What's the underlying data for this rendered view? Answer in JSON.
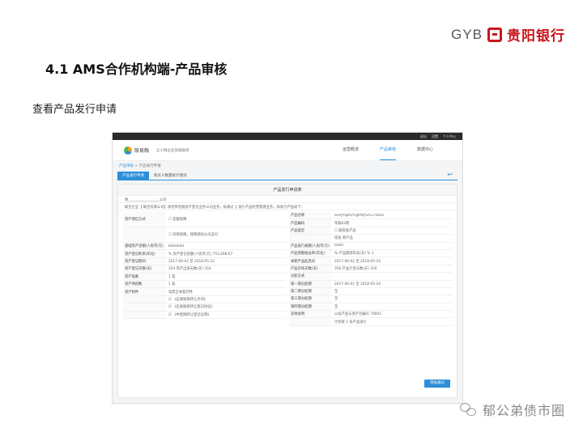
{
  "logo": {
    "latin": "GYB",
    "cn": "贵阳银行"
  },
  "slide": {
    "title": "4.1 AMS合作机构端-产品审核",
    "subtitle": "查看产品发行申请"
  },
  "app": {
    "topbar": [
      "退出",
      "设置",
      "个人中心"
    ],
    "brand": "联易融",
    "slogan": "让小微企业快速融资",
    "nav": [
      "运营概述",
      "产品审核",
      "数据中心"
    ],
    "breadcrumb": [
      "产品审核",
      "产品发行申请"
    ],
    "tabs": [
      "产品发行申请",
      "购买人数量统计情况"
    ],
    "panel_title": "产品发行申请表",
    "lines": [
      "致__________________公司",
      "联合企业【      联合有限公司】承担单金融资产登记业务公司业务，拟通过【      发行产品经营管理业务，拟发行产品如下："
    ],
    "left_rows": [
      {
        "label": "资产增信方式",
        "value": "☐ 差额保障",
        "tall": true
      },
      {
        "label": "",
        "value": "☐ 有限保障，保障授权公司支付",
        "tall": true
      },
      {
        "label": "基础资产金额(人民币/元)",
        "value": "8000000"
      },
      {
        "label": "资产登记利率(年化)",
        "value": "%   资产登记金额(人民币/元)  753,268.67"
      },
      {
        "label": "资产登记期间",
        "value": "2017-06-02   至  2018-05-22"
      },
      {
        "label": "资产登记天数(天)",
        "value": "354   资产出表天数(天)  354"
      },
      {
        "label": "资产笔数",
        "value": "1   笔"
      },
      {
        "label": "资产债权数",
        "value": "1   家"
      },
      {
        "label": "资产附件",
        "value": "电票正本复印件"
      },
      {
        "label": "",
        "value": "☑ 《应收账款转让合同》"
      },
      {
        "label": "",
        "value": "☑ 《应收账款转让登记协议》"
      },
      {
        "label": "",
        "value": "☑ 《中登网转让登记证明》"
      }
    ],
    "right_rows": [
      {
        "label": "产品名称",
        "value": "SFHJYSJKSYQJHNJY20170602"
      },
      {
        "label": "产品编码",
        "value": "年融E2期"
      },
      {
        "label": "产品类型",
        "value": "☐ 融资类产品"
      },
      {
        "label": "",
        "value": "续发      新产品"
      },
      {
        "label": "产品发行规模(人民币/元)",
        "value": "6000"
      },
      {
        "label": "产品预期收益率(年化)",
        "value": "%   产品期限年化(天)  %   1"
      },
      {
        "label": "本期产品起息日",
        "value": "2017-06-02   至  2018-05-24"
      },
      {
        "label": "产品存续天数(天)",
        "value": "356   产品计息天数(天)  356"
      },
      {
        "label": "分配方式",
        "value": ""
      },
      {
        "label": "第一期分配期",
        "value": "2017-06-02   至  2018-05-24"
      },
      {
        "label": "第二期分配期",
        "value": "至"
      },
      {
        "label": "第三期分配期",
        "value": "至"
      },
      {
        "label": "第四期分配期",
        "value": "至"
      },
      {
        "label": "其他说明",
        "value": "以发产品与资产包编号    70001"
      },
      {
        "label": "",
        "value": "计划发   1      份产品发行"
      }
    ],
    "submit_label": "审核通过"
  },
  "watermark": "郁公弟债市圈"
}
